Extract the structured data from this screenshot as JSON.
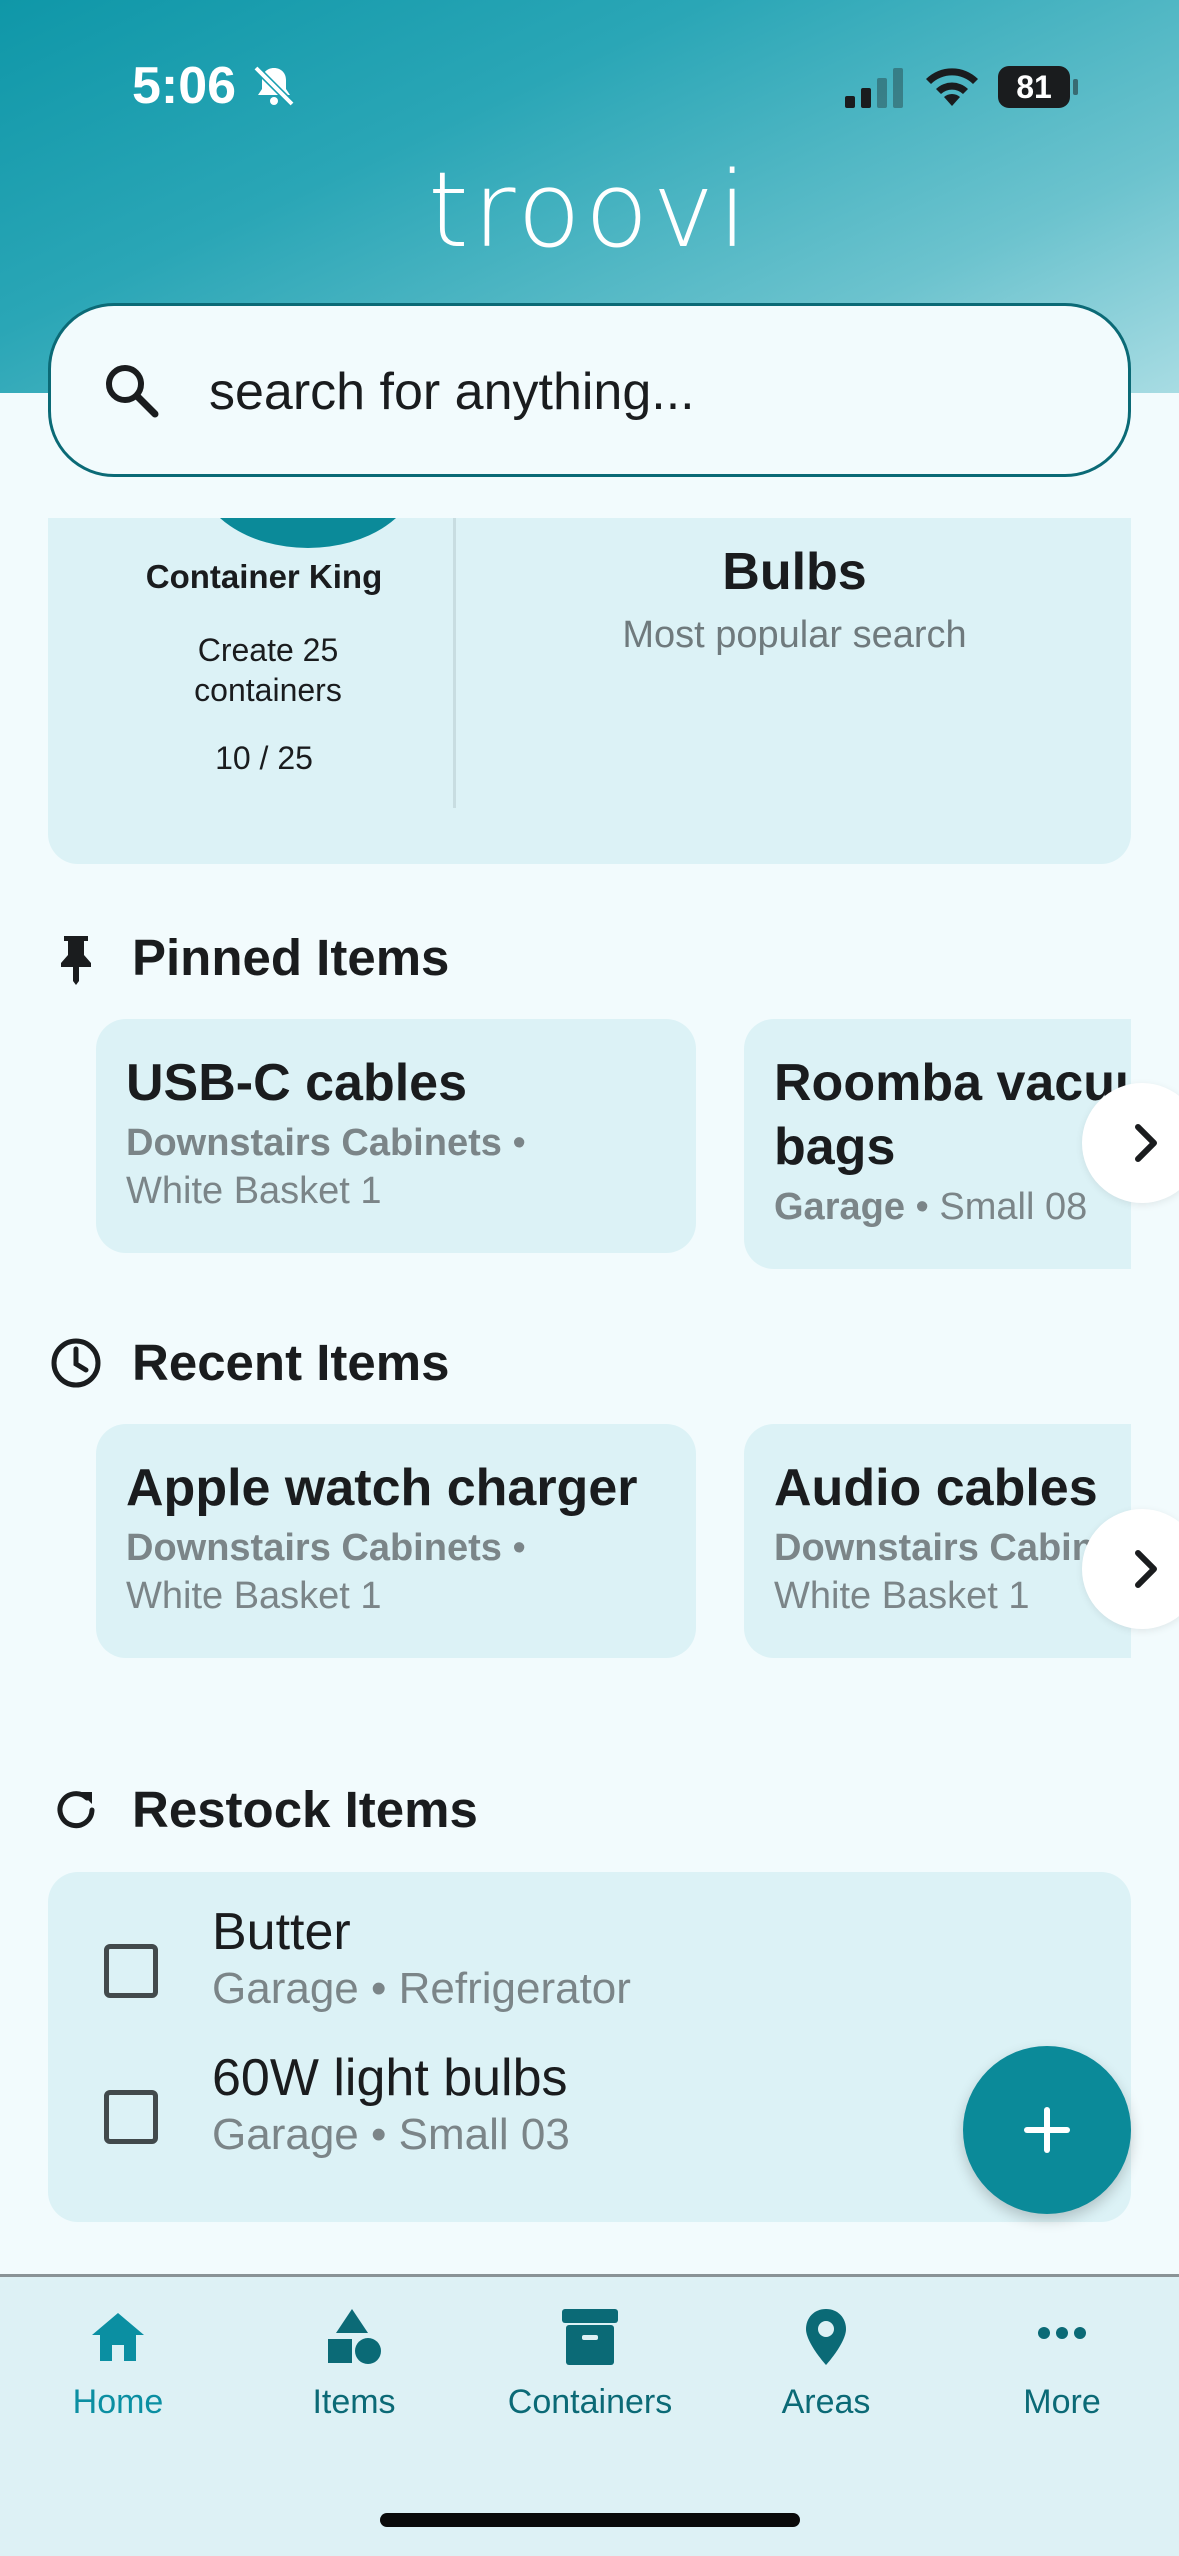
{
  "status_bar": {
    "time": "5:06",
    "battery": "81"
  },
  "app": {
    "logo": "troovi"
  },
  "search": {
    "placeholder": "search for anything..."
  },
  "stats": {
    "badge_title": "Container King",
    "badge_description": "Create 25 containers",
    "badge_progress": "10 / 25",
    "popular_term": "Bulbs",
    "popular_label": "Most popular search"
  },
  "pinned": {
    "title": "Pinned Items",
    "items": [
      {
        "name": "USB-C cables",
        "area": "Downstairs Cabinets",
        "separator": "•",
        "container": "White Basket 1"
      },
      {
        "name": "Roomba vacuum",
        "name_line2": "bags",
        "area": "Garage",
        "separator": "•",
        "container": "Small 08"
      }
    ]
  },
  "recent": {
    "title": "Recent Items",
    "items": [
      {
        "name": "Apple watch charger",
        "area": "Downstairs Cabinets",
        "separator": "•",
        "container": "White Basket 1"
      },
      {
        "name": "Audio cables",
        "area": "Downstairs Cabinets",
        "separator": "•",
        "container": "White Basket 1"
      }
    ]
  },
  "restock": {
    "title": "Restock Items",
    "items": [
      {
        "name": "Butter",
        "location": "Garage • Refrigerator",
        "checked": false
      },
      {
        "name": "60W light bulbs",
        "location": "Garage • Small 03",
        "checked": false
      }
    ]
  },
  "tabs": [
    {
      "label": "Home",
      "icon": "home-icon",
      "active": true
    },
    {
      "label": "Items",
      "icon": "shapes-icon",
      "active": false
    },
    {
      "label": "Containers",
      "icon": "archive-box-icon",
      "active": false
    },
    {
      "label": "Areas",
      "icon": "location-pin-icon",
      "active": false
    },
    {
      "label": "More",
      "icon": "more-dots-icon",
      "active": false
    }
  ],
  "colors": {
    "accent": "#0b8a99",
    "card": "#dcf2f6",
    "background": "#f2fbfd",
    "tab_active": "#0b8fa2"
  }
}
